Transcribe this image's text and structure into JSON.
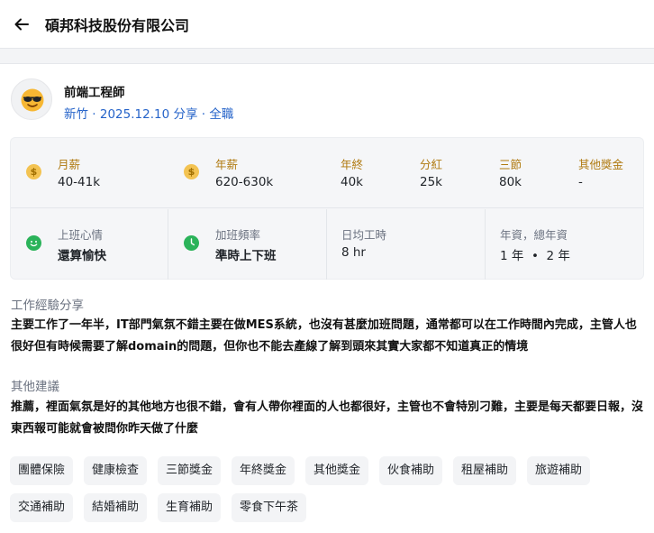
{
  "header": {
    "title": "碩邦科技股份有限公司"
  },
  "post": {
    "job_title": "前端工程師",
    "meta": "新竹 · 2025.12.10 分享 · 全職"
  },
  "salary": {
    "monthly": {
      "label": "月薪",
      "value": "40-41k"
    },
    "annual": {
      "label": "年薪",
      "value": "620-630k"
    },
    "year_end": {
      "label": "年終",
      "value": "40k"
    },
    "dividend": {
      "label": "分紅",
      "value": "25k"
    },
    "festival": {
      "label": "三節",
      "value": "80k"
    },
    "other_bonus": {
      "label": "其他獎金",
      "value": "-"
    }
  },
  "work": {
    "mood": {
      "label": "上班心情",
      "value": "還算愉快"
    },
    "overtime": {
      "label": "加班頻率",
      "value": "準時上下班"
    },
    "daily_hours": {
      "label": "日均工時",
      "value": "8 hr"
    },
    "seniority": {
      "label": "年資，總年資",
      "value": "1 年  •  2 年"
    }
  },
  "experience": {
    "heading": "工作經驗分享",
    "text": "主要工作了一年半，IT部門氣氛不錯主要在做MES系統，也沒有甚麼加班問題，通常都可以在工作時間內完成，主管人也很好但有時候需要了解domain的問題，但你也不能去產線了解到頭來其實大家都不知道真正的情境"
  },
  "advice": {
    "heading": "其他建議",
    "text": "推薦，裡面氣氛是好的其他地方也很不錯，會有人帶你裡面的人也都很好，主管也不會特別刁難，主要是每天都要日報，沒東西報可能就會被問你昨天做了什麼"
  },
  "benefits": [
    "團體保險",
    "健康檢查",
    "三節獎金",
    "年終獎金",
    "其他獎金",
    "伙食補助",
    "租屋補助",
    "旅遊補助",
    "交通補助",
    "結婚補助",
    "生育補助",
    "零食下午茶"
  ],
  "colors": {
    "accent_link": "#2563c9",
    "label_gold": "#b07a10",
    "mood_green": "#2bb35a"
  },
  "icons": {
    "back": "arrow-left-icon",
    "avatar": "sunglasses-emoji-icon",
    "money": "dollar-coin-icon",
    "mood": "smiley-icon",
    "overtime": "clock-icon"
  }
}
